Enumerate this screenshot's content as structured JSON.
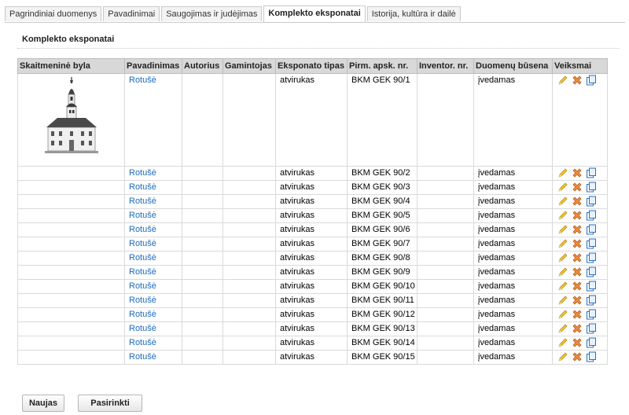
{
  "tabs": [
    {
      "label": "Pagrindiniai duomenys"
    },
    {
      "label": "Pavadinimai"
    },
    {
      "label": "Saugojimas ir judėjimas"
    },
    {
      "label": "Komplekto eksponatai",
      "active": true
    },
    {
      "label": "Istorija, kultūra ir dailė"
    }
  ],
  "panel": {
    "title": "Komplekto eksponatai"
  },
  "table": {
    "headers": {
      "file": "Skaitmeninė byla",
      "name": "Pavadinimas",
      "author": "Autorius",
      "maker": "Gamintojas",
      "type": "Eksponato tipas",
      "reg": "Pirm. apsk. nr.",
      "inv": "Inventor. nr.",
      "status": "Duomenų būsena",
      "actions": "Veiksmai"
    },
    "rows": [
      {
        "name": "Rotušė",
        "author": "",
        "maker": "",
        "type": "atvirukas",
        "reg": "BKM GEK 90/1",
        "inv": "",
        "status": "įvedamas"
      },
      {
        "name": "Rotušė",
        "author": "",
        "maker": "",
        "type": "atvirukas",
        "reg": "BKM GEK 90/2",
        "inv": "",
        "status": "įvedamas"
      },
      {
        "name": "Rotušė",
        "author": "",
        "maker": "",
        "type": "atvirukas",
        "reg": "BKM GEK 90/3",
        "inv": "",
        "status": "įvedamas"
      },
      {
        "name": "Rotušė",
        "author": "",
        "maker": "",
        "type": "atvirukas",
        "reg": "BKM GEK 90/4",
        "inv": "",
        "status": "įvedamas"
      },
      {
        "name": "Rotušė",
        "author": "",
        "maker": "",
        "type": "atvirukas",
        "reg": "BKM GEK 90/5",
        "inv": "",
        "status": "įvedamas"
      },
      {
        "name": "Rotušė",
        "author": "",
        "maker": "",
        "type": "atvirukas",
        "reg": "BKM GEK 90/6",
        "inv": "",
        "status": "įvedamas"
      },
      {
        "name": "Rotušė",
        "author": "",
        "maker": "",
        "type": "atvirukas",
        "reg": "BKM GEK 90/7",
        "inv": "",
        "status": "įvedamas"
      },
      {
        "name": "Rotušė",
        "author": "",
        "maker": "",
        "type": "atvirukas",
        "reg": "BKM GEK 90/8",
        "inv": "",
        "status": "įvedamas"
      },
      {
        "name": "Rotušė",
        "author": "",
        "maker": "",
        "type": "atvirukas",
        "reg": "BKM GEK 90/9",
        "inv": "",
        "status": "įvedamas"
      },
      {
        "name": "Rotušė",
        "author": "",
        "maker": "",
        "type": "atvirukas",
        "reg": "BKM GEK 90/10",
        "inv": "",
        "status": "įvedamas"
      },
      {
        "name": "Rotušė",
        "author": "",
        "maker": "",
        "type": "atvirukas",
        "reg": "BKM GEK 90/11",
        "inv": "",
        "status": "įvedamas"
      },
      {
        "name": "Rotušė",
        "author": "",
        "maker": "",
        "type": "atvirukas",
        "reg": "BKM GEK 90/12",
        "inv": "",
        "status": "įvedamas"
      },
      {
        "name": "Rotušė",
        "author": "",
        "maker": "",
        "type": "atvirukas",
        "reg": "BKM GEK 90/13",
        "inv": "",
        "status": "įvedamas"
      },
      {
        "name": "Rotušė",
        "author": "",
        "maker": "",
        "type": "atvirukas",
        "reg": "BKM GEK 90/14",
        "inv": "",
        "status": "įvedamas"
      },
      {
        "name": "Rotušė",
        "author": "",
        "maker": "",
        "type": "atvirukas",
        "reg": "BKM GEK 90/15",
        "inv": "",
        "status": "įvedamas"
      }
    ],
    "action_icons": [
      "edit-pencil-icon",
      "delete-x-icon",
      "copy-document-icon"
    ]
  },
  "buttons": {
    "new": "Naujas",
    "select": "Pasirinkti"
  },
  "colors": {
    "link": "#1a6bc0",
    "header_bg": "#d8d8d8"
  }
}
